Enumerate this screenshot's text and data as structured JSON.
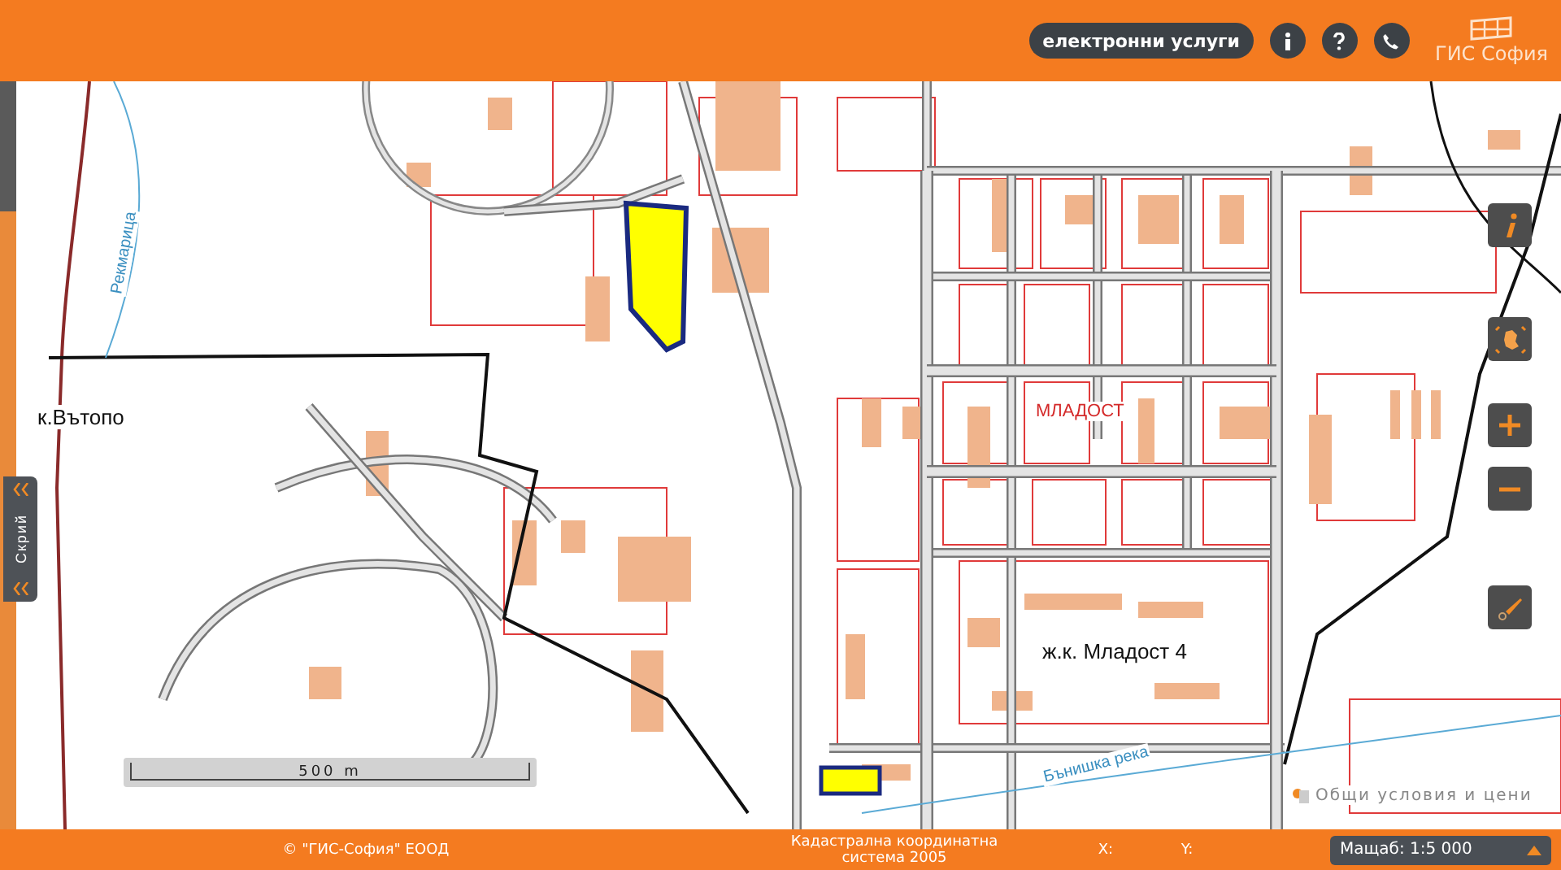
{
  "header": {
    "services_button": "електронни услуги",
    "icon_buttons": [
      {
        "kind": "info"
      },
      {
        "kind": "help"
      },
      {
        "kind": "phone"
      }
    ],
    "logo_text": "ГИС София"
  },
  "side_panel_toggle": {
    "label": "Скрий"
  },
  "map_labels": [
    {
      "kind": "river",
      "text": "Рекмарица"
    },
    {
      "kind": "place",
      "text": "к.Вътопо"
    },
    {
      "kind": "district",
      "text": "МЛАДОСТ"
    },
    {
      "kind": "place",
      "text": "ж.к. Младост 4"
    },
    {
      "kind": "river",
      "text": "Бънишка река"
    }
  ],
  "scale_bar": {
    "label": "500 m"
  },
  "map_tools": [
    {
      "kind": "info"
    },
    {
      "kind": "extent"
    },
    {
      "kind": "zoom-in"
    },
    {
      "kind": "zoom-out"
    },
    {
      "kind": "draw"
    }
  ],
  "terms_link": "Общи условия и цени",
  "footer": {
    "copyright": "© \"ГИС-София\" ЕООД",
    "coordinate_system": "Кадастрална координатна система 2005",
    "x_label": "X:",
    "y_label": "Y:",
    "scale": "Мащаб: 1:5 000"
  }
}
